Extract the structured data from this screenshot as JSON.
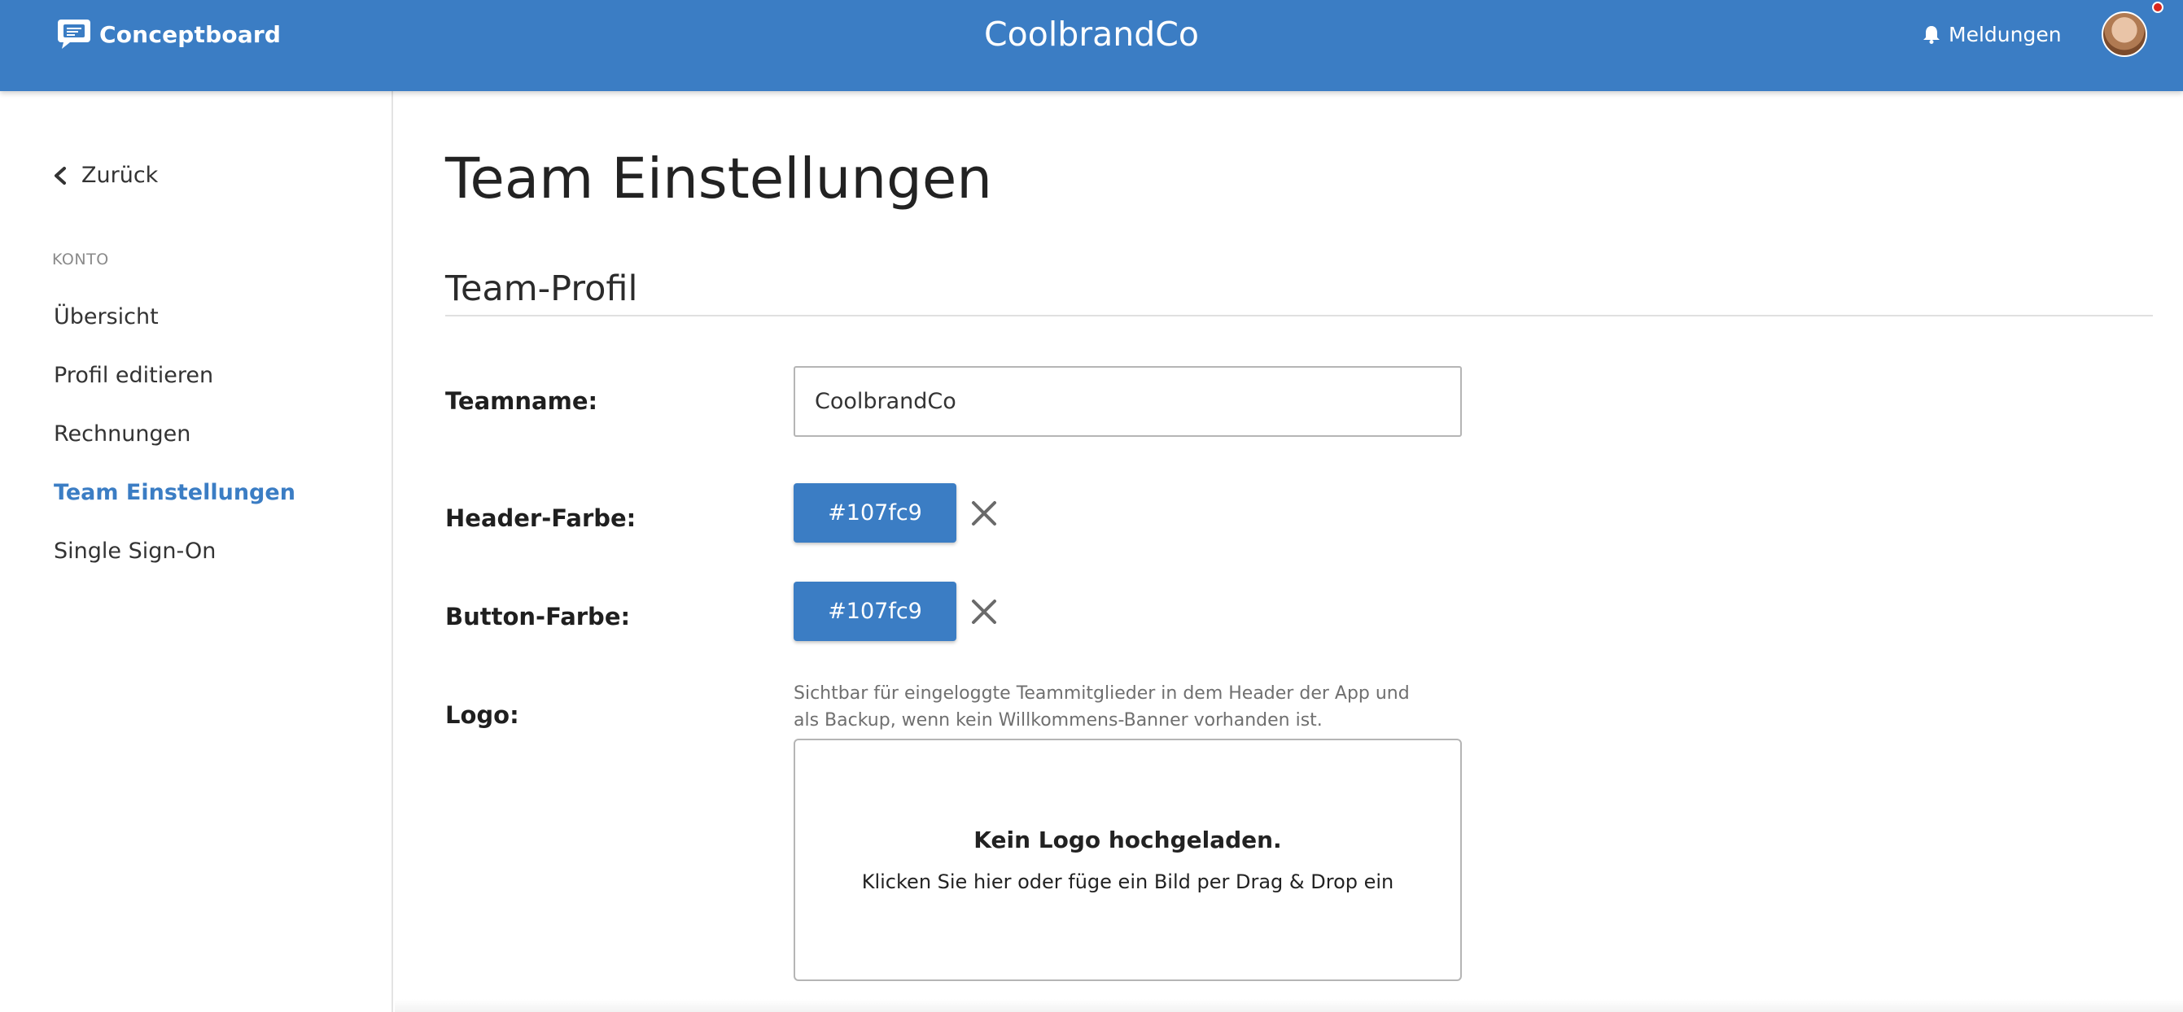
{
  "header": {
    "brand_name": "Conceptboard",
    "team_title": "CoolbrandCo",
    "notifications_label": "Meldungen",
    "brand_color": "#3b7dc4",
    "icons": {
      "brand": "conceptboard-logo-icon",
      "notifications": "bell-icon",
      "avatar": "user-avatar"
    }
  },
  "sidebar": {
    "back_label": "Zurück",
    "section_label": "KONTO",
    "items": [
      {
        "label": "Übersicht",
        "active": false
      },
      {
        "label": "Profil editieren",
        "active": false
      },
      {
        "label": "Rechnungen",
        "active": false
      },
      {
        "label": "Team Einstellungen",
        "active": true
      },
      {
        "label": "Single Sign-On",
        "active": false
      }
    ]
  },
  "main": {
    "page_title": "Team Einstellungen",
    "section_title": "Team-Profil",
    "teamname": {
      "label": "Teamname:",
      "value": "CoolbrandCo"
    },
    "header_color": {
      "label": "Header-Farbe:",
      "value": "#107fc9"
    },
    "button_color": {
      "label": "Button-Farbe:",
      "value": "#107fc9"
    },
    "logo": {
      "label": "Logo:",
      "hint": "Sichtbar für eingeloggte Teammitglieder in dem Header der App und als Backup, wenn kein Willkommens-Banner vorhanden ist.",
      "empty_title": "Kein Logo hochgeladen.",
      "empty_subtitle": "Klicken Sie hier oder füge ein Bild per Drag & Drop ein"
    }
  }
}
